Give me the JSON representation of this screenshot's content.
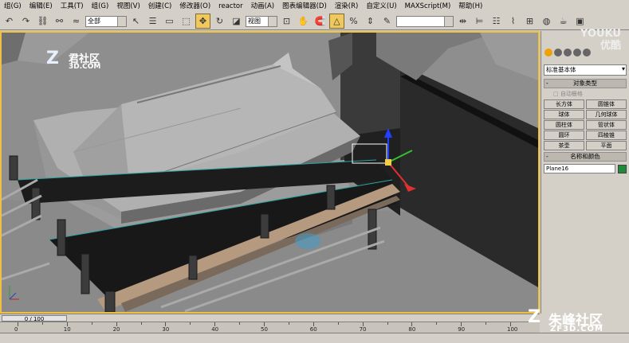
{
  "menu": [
    "组(G)",
    "编辑(E)",
    "工具(T)",
    "组(G)",
    "视图(V)",
    "创建(C)",
    "修改器(O)",
    "reactor",
    "动画(A)",
    "图表编辑器(D)",
    "渲染(R)",
    "自定义(U)",
    "MAXScript(M)",
    "帮助(H)"
  ],
  "toolbar": {
    "selection_filter": "全部",
    "reference_coord": "视图",
    "named_selection": ""
  },
  "icons": {
    "undo": "undo-icon",
    "redo": "redo-icon",
    "select": "select-arrow-icon",
    "move": "move-icon",
    "rotate": "rotate-icon",
    "scale": "scale-icon",
    "snap": "snap-icon",
    "material": "material-editor-icon",
    "render": "render-teapot-icon"
  },
  "watermark_tl": {
    "logo": "Z",
    "name": "君社区",
    "domain": "3D.COM"
  },
  "watermark_yk": {
    "line1": "YOUKU",
    "line2": "优酷"
  },
  "command_panel": {
    "category": "标准基本体",
    "object_type": {
      "title": "对象类型",
      "autogrid": "自动栅格",
      "buttons": [
        "长方体",
        "圆锥体",
        "球体",
        "几何球体",
        "圆柱体",
        "管状体",
        "圆环",
        "四棱锥",
        "茶壶",
        "平面"
      ]
    },
    "name_color": {
      "title": "名称和颜色",
      "name": "Plane16",
      "color": "#1e8a3a"
    }
  },
  "timeline": {
    "current": "0 / 100",
    "ticks": [
      "0",
      "10",
      "20",
      "30",
      "40",
      "50",
      "60",
      "70",
      "80",
      "90",
      "100"
    ]
  },
  "watermark_br": {
    "logo": "Z",
    "name": "朱峰社区",
    "domain": "ZF3D.COM"
  }
}
